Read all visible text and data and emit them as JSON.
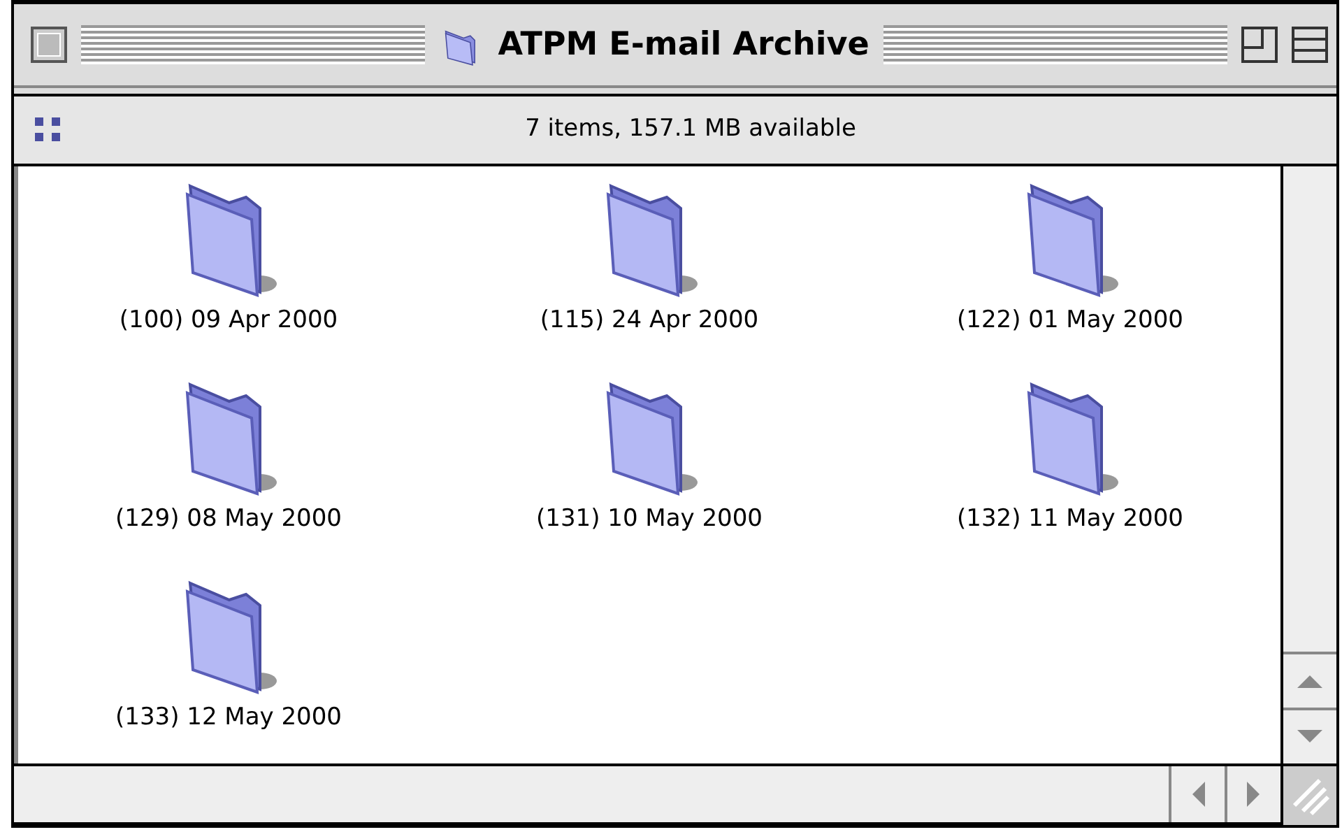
{
  "window": {
    "title": "ATPM E-mail Archive"
  },
  "header": {
    "status": "7 items, 157.1 MB available"
  },
  "items": [
    {
      "label": "(100) 09 Apr 2000"
    },
    {
      "label": "(115) 24 Apr 2000"
    },
    {
      "label": "(122) 01 May 2000"
    },
    {
      "label": "(129) 08 May 2000"
    },
    {
      "label": "(131) 10 May 2000"
    },
    {
      "label": "(132) 11 May 2000"
    },
    {
      "label": "(133) 12 May 2000"
    }
  ]
}
